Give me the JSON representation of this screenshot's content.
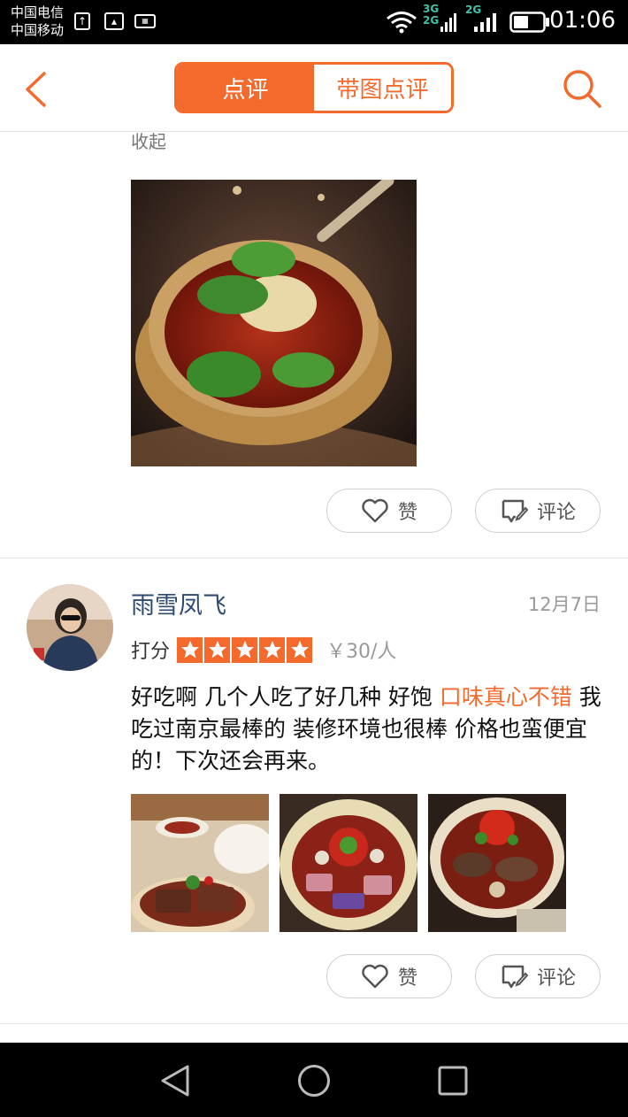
{
  "status_bar": {
    "carrier1": "中国电信",
    "carrier2": "中国移动",
    "net1": "3G",
    "net2": "2G",
    "net3": "2G",
    "time": "01:06"
  },
  "header": {
    "tabs": [
      {
        "label": "点评",
        "active": true
      },
      {
        "label": "带图点评",
        "active": false
      }
    ],
    "accent_color": "#f46a2d"
  },
  "feed": {
    "prev_review": {
      "collapse_label": "收起",
      "like_label": "赞",
      "comment_label": "评论"
    },
    "review": {
      "user_name": "雨雪凤飞",
      "date": "12月7日",
      "rating_label": "打分",
      "stars": 5,
      "price": "￥30/人",
      "text_part1": "好吃啊 几个人吃了好几种 好饱 ",
      "text_highlight": "口味真心不错",
      "text_part2": " 我吃过南京最棒的 装修环境也很棒 价格也蛮便宜的！下次还会再来。",
      "photo_count": 3,
      "like_label": "赞",
      "comment_label": "评论"
    }
  }
}
